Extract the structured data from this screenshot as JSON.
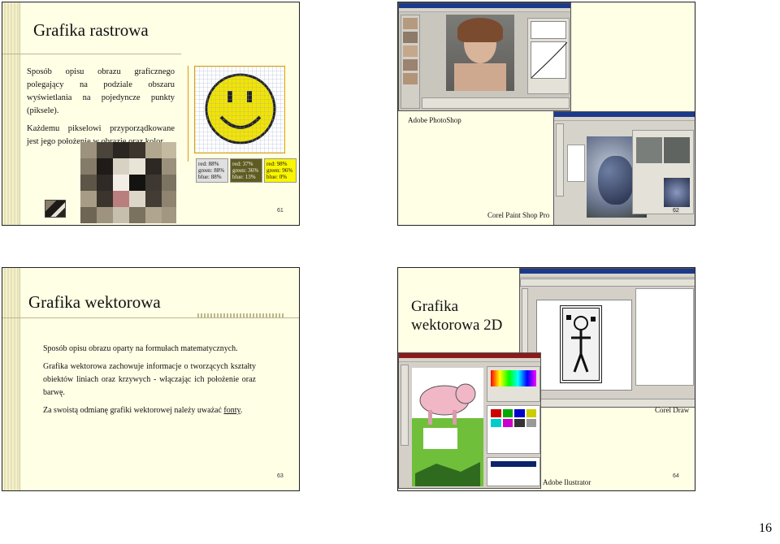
{
  "slide1": {
    "title": "Grafika rastrowa",
    "body1": "Sposób opisu obrazu graficznego polegający na podziale obszaru wyświetlania na pojedyncze punkty (piksele).",
    "body2": "Każdemu pikselowi przyporządkowane jest jego położenie w obrazie oraz kolor.",
    "page": "61",
    "swatches": [
      {
        "r": "red: 88%",
        "g": "green: 88%",
        "b": "blue: 88%",
        "bg": "#e0e0e0",
        "fg": "#111111"
      },
      {
        "r": "red: 37%",
        "g": "green: 36%",
        "b": "blue: 13%",
        "bg": "#5f5c21",
        "fg": "#f0f0f0"
      },
      {
        "r": "red: 98%",
        "g": "green: 96%",
        "b": "blue: 0%",
        "bg": "#faf500",
        "fg": "#111111"
      }
    ]
  },
  "slide2": {
    "caption_top": "Adobe PhotoShop",
    "caption_bottom": "Corel Paint Shop Pro",
    "page": "62"
  },
  "slide3": {
    "title": "Grafika wektorowa",
    "body1": "Sposób opisu obrazu oparty na formułach matematycznych.",
    "body2": "Grafika wektorowa zachowuje informacje o tworzących kształty obiektów liniach oraz krzywych - włączając ich położenie oraz barwę.",
    "body3_pre": "Za swoistą odmianę grafiki wektorowej należy uważać ",
    "body3_link": "fonty",
    "body3_post": ".",
    "page": "63"
  },
  "slide4": {
    "title_line1": "Grafika",
    "title_line2": "wektorowa 2D",
    "caption_right": "Corel Draw",
    "caption_bottom": "Adobe Ilustrator",
    "page": "64"
  },
  "sheet_page": "16"
}
